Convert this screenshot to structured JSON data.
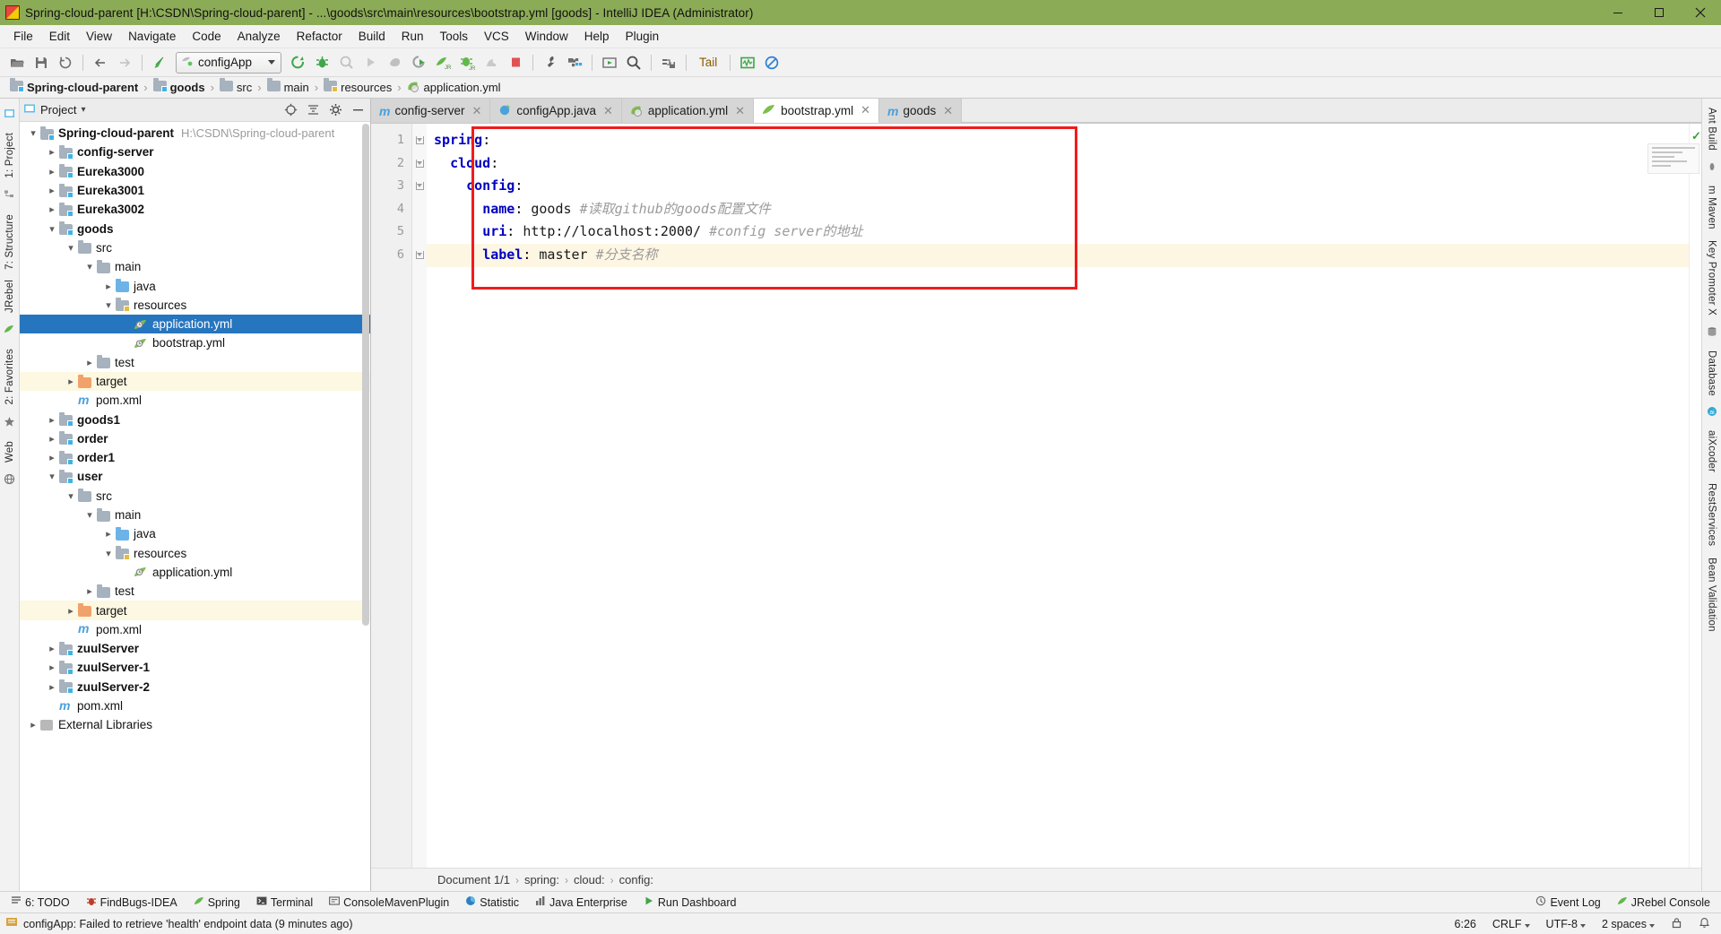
{
  "window": {
    "title": "Spring-cloud-parent [H:\\CSDN\\Spring-cloud-parent] - ...\\goods\\src\\main\\resources\\bootstrap.yml [goods] - IntelliJ IDEA (Administrator)",
    "minimize": "—",
    "maximize": "❐",
    "close": "✕",
    "titlebar_color": "#8cab56"
  },
  "menu": {
    "items": [
      {
        "label": "File",
        "mnemonic": "F"
      },
      {
        "label": "Edit",
        "mnemonic": "E"
      },
      {
        "label": "View",
        "mnemonic": "V"
      },
      {
        "label": "Navigate",
        "mnemonic": "N"
      },
      {
        "label": "Code",
        "mnemonic": "C"
      },
      {
        "label": "Analyze",
        "mnemonic": "z"
      },
      {
        "label": "Refactor",
        "mnemonic": "R"
      },
      {
        "label": "Build",
        "mnemonic": "B"
      },
      {
        "label": "Run",
        "mnemonic": "u"
      },
      {
        "label": "Tools",
        "mnemonic": "T"
      },
      {
        "label": "VCS",
        "mnemonic": "S"
      },
      {
        "label": "Window",
        "mnemonic": "W"
      },
      {
        "label": "Help",
        "mnemonic": "H"
      },
      {
        "label": "Plugin",
        "mnemonic": "g"
      }
    ]
  },
  "toolbar": {
    "run_config": "configApp",
    "tail_label": "Tail",
    "buttons": [
      "open-folder-icon",
      "save-all-icon",
      "sync-refresh-icon",
      "back-arrow-icon",
      "forward-arrow-icon",
      "revert-icon",
      "rerun-icon",
      "debug-icon",
      "coverage-icon",
      "run-icon",
      "stop-gray-icon",
      "profile-icon",
      "jrebel-run-icon",
      "jrebel-debug-icon",
      "rabbit-icon",
      "stop-red-icon",
      "settings-wrench-icon",
      "project-structure-icon",
      "update-icon",
      "search-everywhere-icon",
      "database-connect-icon",
      "monitor-icon",
      "suppress-icon"
    ]
  },
  "breadcrumb": {
    "items": [
      {
        "label": "Spring-cloud-parent",
        "icon": "module-folder-icon",
        "bold": true
      },
      {
        "label": "goods",
        "icon": "module-folder-icon",
        "bold": true
      },
      {
        "label": "src",
        "icon": "folder-icon",
        "bold": false
      },
      {
        "label": "main",
        "icon": "folder-icon",
        "bold": false
      },
      {
        "label": "resources",
        "icon": "resource-folder-icon",
        "bold": false
      },
      {
        "label": "application.yml",
        "icon": "yaml-leaf-icon",
        "bold": false
      }
    ],
    "separator": "›"
  },
  "left_strip": {
    "tabs": [
      {
        "label": "1: Project",
        "name": "tool-window-project"
      },
      {
        "label": "7: Structure",
        "name": "tool-window-structure"
      },
      {
        "label": "JRebel",
        "name": "tool-window-jrebel"
      },
      {
        "label": "2: Favorites",
        "name": "tool-window-favorites"
      },
      {
        "label": "Web",
        "name": "tool-window-web"
      }
    ]
  },
  "right_strip": {
    "tabs": [
      {
        "label": "Ant Build",
        "name": "tool-window-ant-build"
      },
      {
        "label": "m Maven",
        "name": "tool-window-maven"
      },
      {
        "label": "Key Promoter X",
        "name": "tool-window-key-promoter"
      },
      {
        "label": "Database",
        "name": "tool-window-database"
      },
      {
        "label": "aiXcoder",
        "name": "tool-window-aixcoder"
      },
      {
        "label": "RestServices",
        "name": "tool-window-restservices"
      },
      {
        "label": "Bean Validation",
        "name": "tool-window-bean-validation"
      }
    ]
  },
  "project_panel": {
    "title": "Project",
    "dropdown_caret": "▾",
    "locate_icon": "crosshair-icon",
    "collapse_icon": "collapse-all-icon",
    "settings_icon": "gear-icon",
    "hide_icon": "hide-icon",
    "tree": [
      {
        "label": "Spring-cloud-parent",
        "path": "H:\\CSDN\\Spring-cloud-parent",
        "depth": 0,
        "arrow": "down",
        "icon": "module-folder",
        "bold": true
      },
      {
        "label": "config-server",
        "depth": 1,
        "arrow": "right",
        "icon": "module-folder",
        "bold": true
      },
      {
        "label": "Eureka3000",
        "depth": 1,
        "arrow": "right",
        "icon": "module-folder",
        "bold": true
      },
      {
        "label": "Eureka3001",
        "depth": 1,
        "arrow": "right",
        "icon": "module-folder",
        "bold": true
      },
      {
        "label": "Eureka3002",
        "depth": 1,
        "arrow": "right",
        "icon": "module-folder",
        "bold": true
      },
      {
        "label": "goods",
        "depth": 1,
        "arrow": "down",
        "icon": "module-folder",
        "bold": true
      },
      {
        "label": "src",
        "depth": 2,
        "arrow": "down",
        "icon": "folder",
        "bold": false
      },
      {
        "label": "main",
        "depth": 3,
        "arrow": "down",
        "icon": "folder",
        "bold": false
      },
      {
        "label": "java",
        "depth": 4,
        "arrow": "right",
        "icon": "src-folder",
        "bold": false
      },
      {
        "label": "resources",
        "depth": 4,
        "arrow": "down",
        "icon": "resource-folder",
        "bold": false
      },
      {
        "label": "application.yml",
        "depth": 5,
        "arrow": "none",
        "icon": "yaml-leaf",
        "bold": false,
        "state": "selected"
      },
      {
        "label": "bootstrap.yml",
        "depth": 5,
        "arrow": "none",
        "icon": "yaml-leaf",
        "bold": false
      },
      {
        "label": "test",
        "depth": 3,
        "arrow": "right",
        "icon": "folder",
        "bold": false
      },
      {
        "label": "target",
        "depth": 2,
        "arrow": "right",
        "icon": "orange-folder",
        "bold": false,
        "state": "highlight"
      },
      {
        "label": "pom.xml",
        "depth": 2,
        "arrow": "none",
        "icon": "maven-file",
        "bold": false
      },
      {
        "label": "goods1",
        "depth": 1,
        "arrow": "right",
        "icon": "module-folder",
        "bold": true
      },
      {
        "label": "order",
        "depth": 1,
        "arrow": "right",
        "icon": "module-folder",
        "bold": true
      },
      {
        "label": "order1",
        "depth": 1,
        "arrow": "right",
        "icon": "module-folder",
        "bold": true
      },
      {
        "label": "user",
        "depth": 1,
        "arrow": "down",
        "icon": "module-folder",
        "bold": true
      },
      {
        "label": "src",
        "depth": 2,
        "arrow": "down",
        "icon": "folder",
        "bold": false
      },
      {
        "label": "main",
        "depth": 3,
        "arrow": "down",
        "icon": "folder",
        "bold": false
      },
      {
        "label": "java",
        "depth": 4,
        "arrow": "right",
        "icon": "src-folder",
        "bold": false
      },
      {
        "label": "resources",
        "depth": 4,
        "arrow": "down",
        "icon": "resource-folder",
        "bold": false
      },
      {
        "label": "application.yml",
        "depth": 5,
        "arrow": "none",
        "icon": "yaml-leaf",
        "bold": false
      },
      {
        "label": "test",
        "depth": 3,
        "arrow": "right",
        "icon": "folder",
        "bold": false
      },
      {
        "label": "target",
        "depth": 2,
        "arrow": "right",
        "icon": "orange-folder",
        "bold": false,
        "state": "highlight"
      },
      {
        "label": "pom.xml",
        "depth": 2,
        "arrow": "none",
        "icon": "maven-file",
        "bold": false
      },
      {
        "label": "zuulServer",
        "depth": 1,
        "arrow": "right",
        "icon": "module-folder",
        "bold": true
      },
      {
        "label": "zuulServer-1",
        "depth": 1,
        "arrow": "right",
        "icon": "module-folder",
        "bold": true
      },
      {
        "label": "zuulServer-2",
        "depth": 1,
        "arrow": "right",
        "icon": "module-folder",
        "bold": true
      },
      {
        "label": "pom.xml",
        "depth": 1,
        "arrow": "none",
        "icon": "maven-file",
        "bold": false
      },
      {
        "label": "External Libraries",
        "depth": 0,
        "arrow": "right",
        "icon": "library",
        "bold": false
      }
    ]
  },
  "editor": {
    "tabs": [
      {
        "label": "config-server",
        "icon": "maven-file-icon",
        "active": false,
        "close": "✕"
      },
      {
        "label": "configApp.java",
        "icon": "spring-bean-icon",
        "active": false,
        "close": "✕"
      },
      {
        "label": "application.yml",
        "icon": "yaml-leaf-icon",
        "active": false,
        "close": "✕"
      },
      {
        "label": "bootstrap.yml",
        "icon": "yaml-leaf-icon",
        "active": true,
        "close": "✕"
      },
      {
        "label": "goods",
        "icon": "maven-file-icon",
        "active": false,
        "close": "✕"
      }
    ],
    "line_numbers": [
      "1",
      "2",
      "3",
      "4",
      "5",
      "6"
    ],
    "lines": [
      {
        "n": 1,
        "indent": 0,
        "key": "spring",
        "colon": ":",
        "value": "",
        "comment": "",
        "fold": true,
        "current": false
      },
      {
        "n": 2,
        "indent": 1,
        "key": "cloud",
        "colon": ":",
        "value": "",
        "comment": "",
        "fold": true,
        "current": false
      },
      {
        "n": 3,
        "indent": 2,
        "key": "config",
        "colon": ":",
        "value": "",
        "comment": "",
        "fold": true,
        "current": false
      },
      {
        "n": 4,
        "indent": 3,
        "key": "name",
        "colon": ":",
        "value": " goods ",
        "comment": "#读取github的goods配置文件",
        "fold": false,
        "current": false
      },
      {
        "n": 5,
        "indent": 3,
        "key": "uri",
        "colon": ":",
        "value": " http://localhost:2000/ ",
        "comment": "#config server的地址",
        "fold": false,
        "current": false
      },
      {
        "n": 6,
        "indent": 3,
        "key": "label",
        "colon": ":",
        "value": " master ",
        "comment": "#分支名称",
        "fold": true,
        "current": true
      }
    ],
    "annotation_box_color": "#f01c1c",
    "inspection_status": "✓",
    "status_path": [
      "Document 1/1",
      "spring:",
      "cloud:",
      "config:"
    ],
    "status_separator": "›"
  },
  "bottom_toolstrip": {
    "items": [
      {
        "label": "6: TODO",
        "icon": "todo-icon",
        "mnemonic": "6"
      },
      {
        "label": "FindBugs-IDEA",
        "icon": "findbugs-icon"
      },
      {
        "label": "Spring",
        "icon": "spring-leaf-icon"
      },
      {
        "label": "Terminal",
        "icon": "terminal-icon"
      },
      {
        "label": "ConsoleMavenPlugin",
        "icon": "maven-console-icon"
      },
      {
        "label": "Statistic",
        "icon": "statistic-icon"
      },
      {
        "label": "Java Enterprise",
        "icon": "java-ee-icon"
      },
      {
        "label": "Run Dashboard",
        "icon": "run-dashboard-icon"
      }
    ],
    "right_items": [
      {
        "label": "Event Log",
        "icon": "event-log-icon"
      },
      {
        "label": "JRebel Console",
        "icon": "jrebel-icon"
      }
    ]
  },
  "statusbar": {
    "message": "configApp: Failed to retrieve 'health' endpoint data (9 minutes ago)",
    "message_icon": "warning-icon",
    "caret_position": "6:26",
    "line_separator": "CRLF",
    "encoding": "UTF-8",
    "indent": "2 spaces",
    "lock_icon": "lock-icon",
    "notification_icon": "bell-icon"
  }
}
